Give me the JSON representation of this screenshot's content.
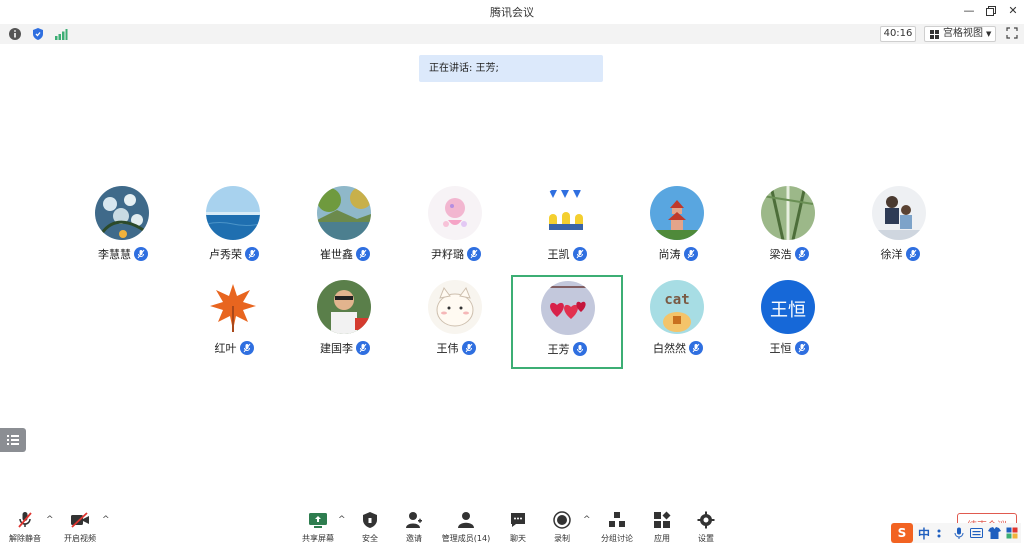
{
  "window": {
    "title": "腾讯会议",
    "controls": [
      "minimize",
      "restore",
      "close"
    ]
  },
  "toolbar": {
    "timer": "40:16",
    "view_label": "宫格视图",
    "icons": [
      "info-icon",
      "shield-icon",
      "signal-icon",
      "grid-icon",
      "fullscreen-icon"
    ]
  },
  "speaking": {
    "text": "正在讲话: 王芳;"
  },
  "participants": [
    {
      "name": "李慧慧",
      "avatar": "flower-painting"
    },
    {
      "name": "卢秀荣",
      "avatar": "ocean"
    },
    {
      "name": "崔世鑫",
      "avatar": "lake-scenery"
    },
    {
      "name": "尹籽璐",
      "avatar": "pink-cartoon"
    },
    {
      "name": "王凯",
      "avatar": "minions"
    },
    {
      "name": "尚涛",
      "avatar": "pagoda"
    },
    {
      "name": "梁浩",
      "avatar": "bamboo"
    },
    {
      "name": "徐洋",
      "avatar": "family-photo"
    },
    {
      "name": "红叶",
      "avatar": "maple-leaf"
    },
    {
      "name": "建国李",
      "avatar": "man-photo"
    },
    {
      "name": "王伟",
      "avatar": "cute-cat"
    },
    {
      "name": "王芳",
      "avatar": "red-hearts",
      "speaking": true
    },
    {
      "name": "白然然",
      "avatar": "cat-text"
    },
    {
      "name": "王恒",
      "avatar": "text-avatar",
      "avatar_text": "王恒"
    }
  ],
  "bottom": {
    "unmute": "解除静音",
    "start_video": "开启视频",
    "share_screen": "共享屏幕",
    "security": "安全",
    "invite": "邀请",
    "manage_members": "管理成员(14)",
    "chat": "聊天",
    "record": "录制",
    "breakout": "分组讨论",
    "apps": "应用",
    "settings": "设置",
    "end_meeting": "结束会议"
  },
  "ime": {
    "logo": "S",
    "mode": "中"
  },
  "colors": {
    "accent": "#2f6fe0",
    "speaking_border": "#3cae74",
    "banner_bg": "#dce9fb",
    "end_red": "#e05a4f"
  }
}
